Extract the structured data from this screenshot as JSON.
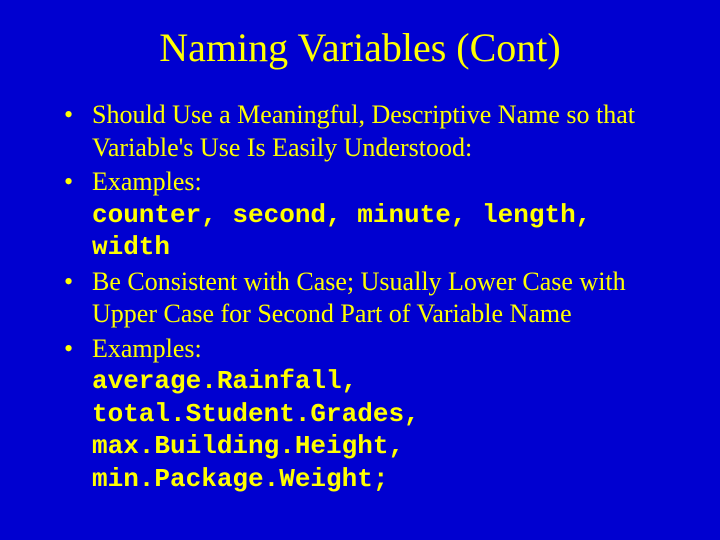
{
  "title": "Naming Variables (Cont)",
  "bullets": [
    {
      "text": "Should Use a Meaningful, Descriptive Name so that Variable's Use Is Easily Understood:"
    },
    {
      "text": "Examples:",
      "code": "counter, second, minute, length, width"
    },
    {
      "text": "Be Consistent with Case; Usually Lower Case with Upper Case for Second Part of Variable Name"
    },
    {
      "text": "Examples:",
      "code": "average.Rainfall, total.Student.Grades, max.Building.Height, min.Package.Weight;"
    }
  ]
}
